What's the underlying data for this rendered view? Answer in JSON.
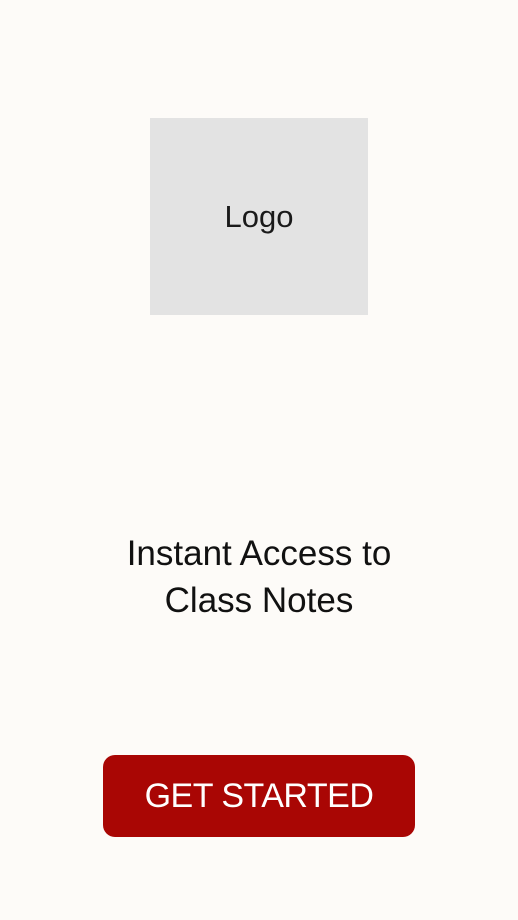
{
  "colors": {
    "background": "#fdfbf8",
    "logo_placeholder": "#e3e3e3",
    "button": "#a90604",
    "button_text": "#ffffff"
  },
  "logo": {
    "label": "Logo"
  },
  "tagline": {
    "line1": "Instant Access to",
    "line2": "Class Notes"
  },
  "cta": {
    "label": "GET STARTED"
  }
}
